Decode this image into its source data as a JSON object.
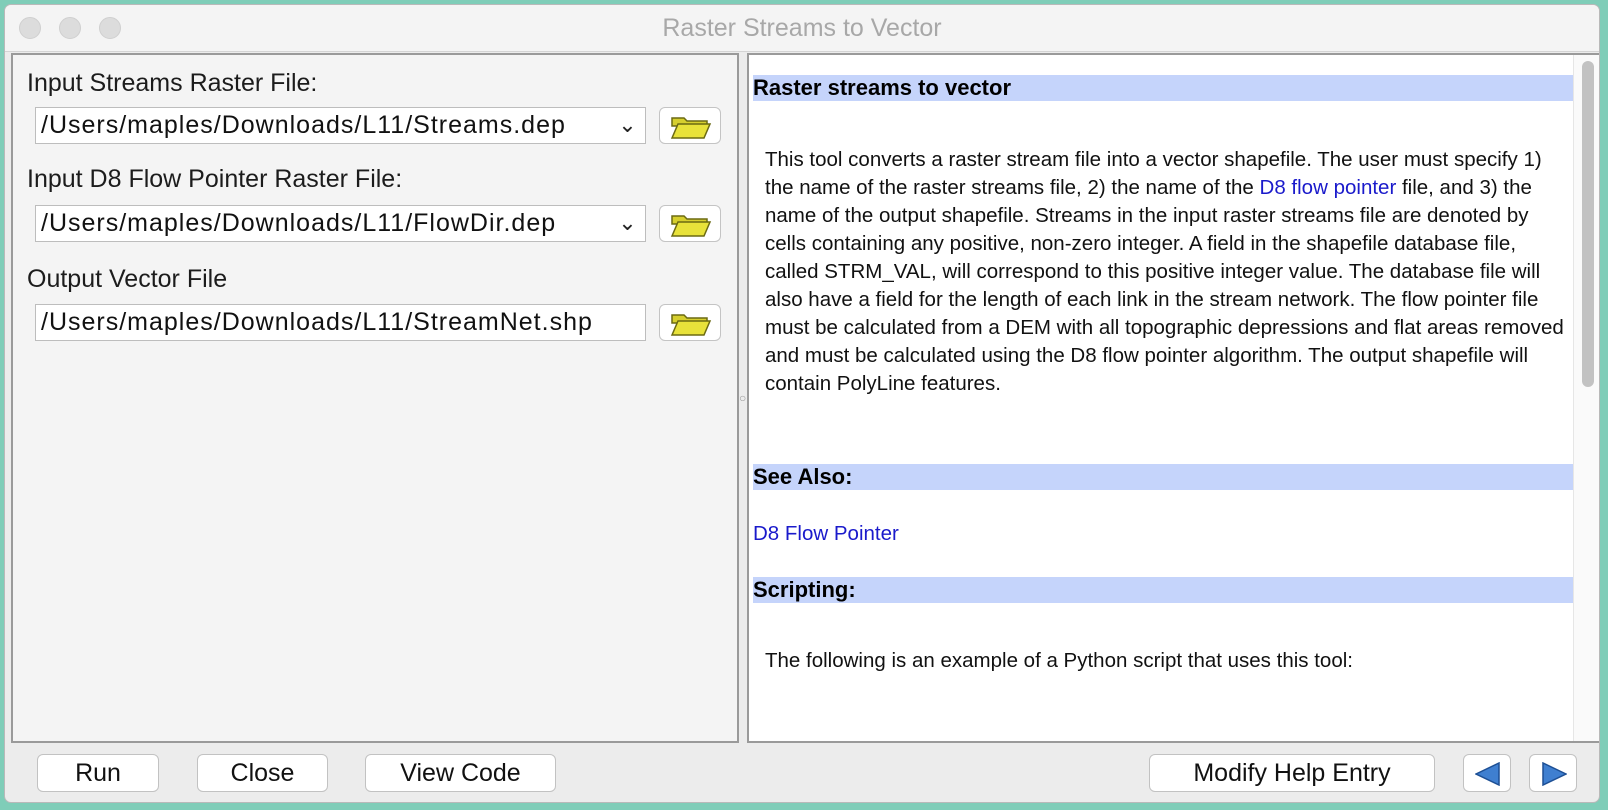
{
  "window": {
    "title": "Raster Streams to Vector"
  },
  "form": {
    "input_streams": {
      "label": "Input Streams Raster File:",
      "value": "/Users/maples/Downloads/L11/Streams.dep"
    },
    "input_d8": {
      "label": "Input D8 Flow Pointer Raster File:",
      "value": "/Users/maples/Downloads/L11/FlowDir.dep"
    },
    "output_vector": {
      "label": "Output Vector File",
      "value": "/Users/maples/Downloads/L11/StreamNet.shp"
    }
  },
  "help": {
    "heading": "Raster streams to vector",
    "desc_part1": "This tool converts a raster stream file into a vector shapefile. The user must specify 1) the name of the raster streams file, 2) the name of the ",
    "desc_link": "D8 flow pointer",
    "desc_part2": " file, and 3) the name of the output shapefile. Streams in the input raster streams file are denoted by cells containing any positive, non-zero integer. A field in the shapefile database file, called STRM_VAL, will correspond to this positive integer value. The database file will also have a field for the length of each link in the stream network. The flow pointer file must be calculated from a DEM with all topographic depressions and flat areas removed and must be calculated using the D8 flow pointer algorithm. The output shapefile will contain PolyLine features.",
    "see_also_heading": "See Also:",
    "see_also_link": "D8 Flow Pointer",
    "scripting_heading": "Scripting:",
    "scripting_text": "The following is an example of a Python script that uses this tool:"
  },
  "buttons": {
    "run": "Run",
    "close": "Close",
    "view_code": "View Code",
    "modify_help": "Modify Help Entry"
  },
  "icons": {
    "browse": "folder-open-icon",
    "back": "arrow-left-icon",
    "forward": "arrow-right-icon",
    "dropdown": "chevron-down-icon"
  }
}
